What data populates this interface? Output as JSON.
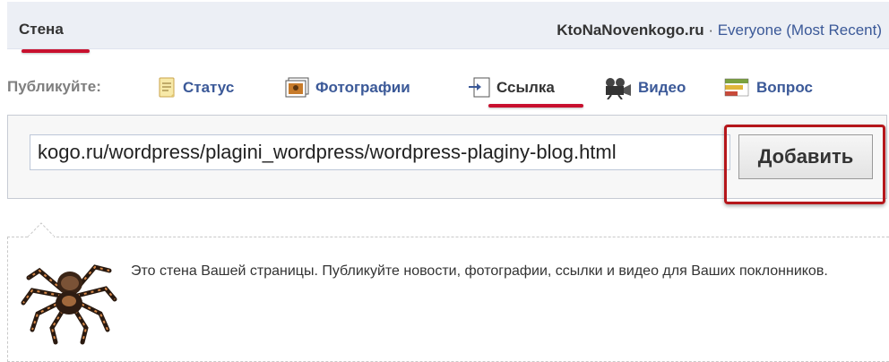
{
  "header": {
    "tab_label": "Стена",
    "site_name": "KtoNaNovenkogo.ru",
    "separator": " · ",
    "filter_label": "Everyone (Most Recent)"
  },
  "publish": {
    "label": "Публикуйте:",
    "items": [
      {
        "label": "Статус",
        "icon": "status-icon"
      },
      {
        "label": "Фотографии",
        "icon": "photo-icon"
      },
      {
        "label": "Ссылка",
        "icon": "link-icon"
      },
      {
        "label": "Видео",
        "icon": "video-icon"
      },
      {
        "label": "Вопрос",
        "icon": "question-icon"
      }
    ],
    "active_item": "Ссылка"
  },
  "composer": {
    "url_value": "kogo.ru/wordpress/plagini_wordpress/wordpress-plaginy-blog.html",
    "add_button_label": "Добавить"
  },
  "wall": {
    "message": "Это стена Вашей страницы. Публикуйте новости, фотографии, ссылки и видео для Ваших поклонников."
  },
  "colors": {
    "link": "#3b5998",
    "highlight": "#c8102e",
    "header_bg": "#eceff5"
  }
}
